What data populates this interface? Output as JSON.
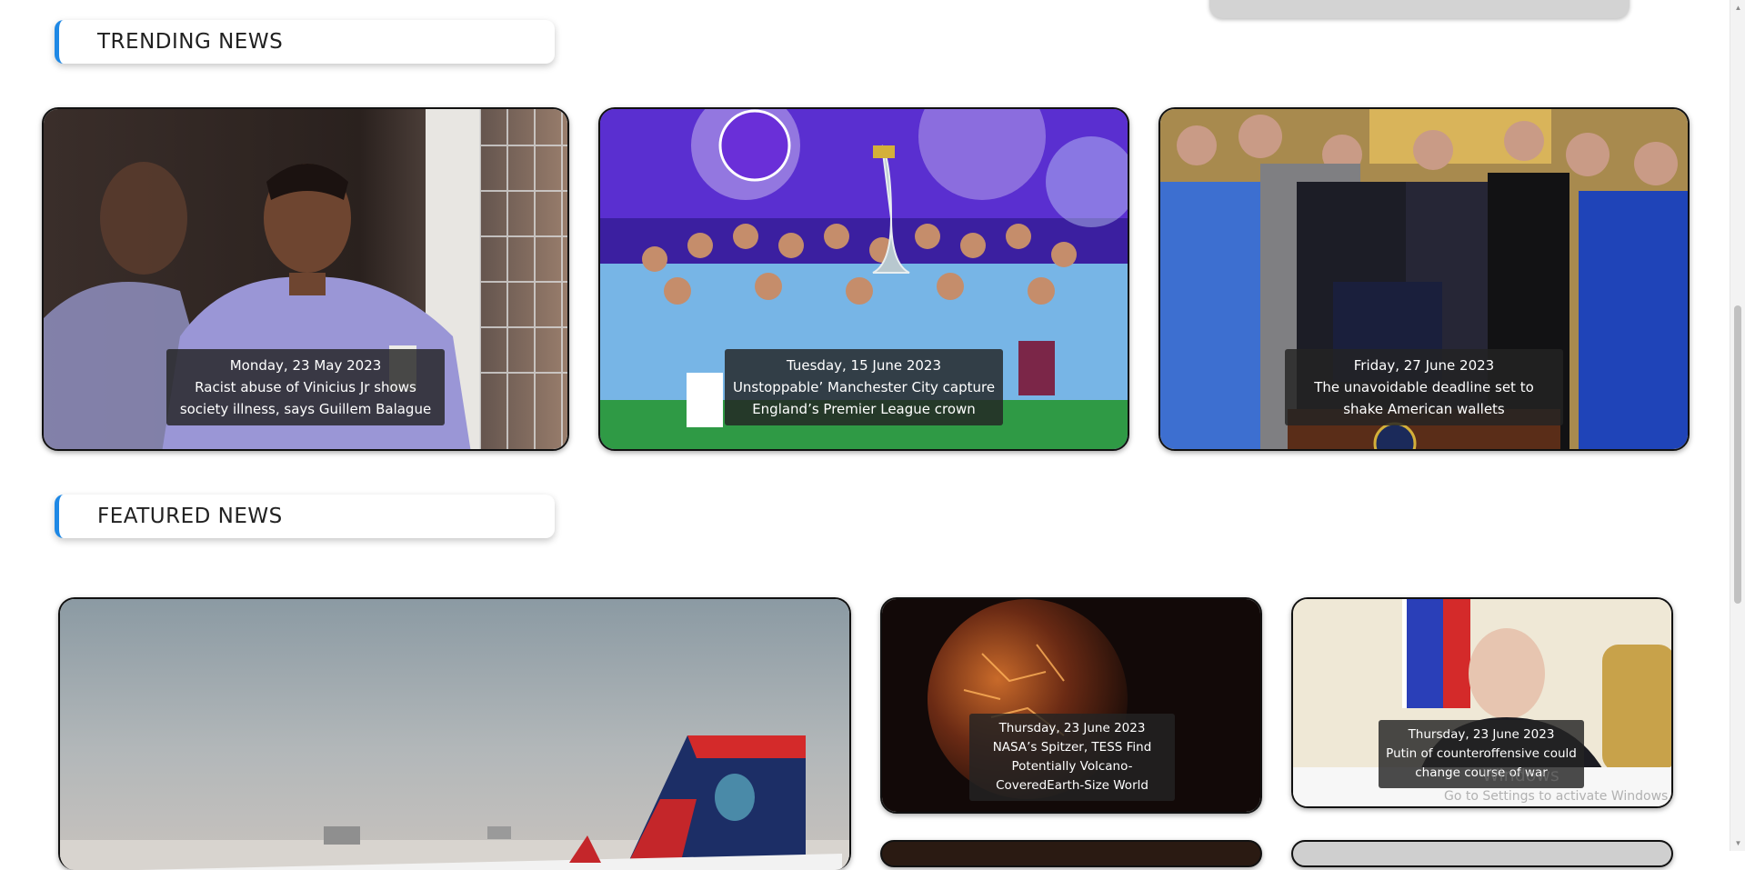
{
  "sections": {
    "trending_title": "TRENDING NEWS",
    "featured_title": "FEATURED NEWS"
  },
  "trending": [
    {
      "date": "Monday, 23 May 2023",
      "title": "Racist abuse of Vinicius Jr shows society illness, says Guillem Balague"
    },
    {
      "date": "Tuesday, 15 June 2023",
      "title": "Unstoppable’ Manchester City capture England’s Premier League crown"
    },
    {
      "date": "Friday, 27 June 2023",
      "title": "The unavoidable deadline set to shake American wallets"
    }
  ],
  "featured": [
    {
      "date": "Thursday, 23 June 2023",
      "title": "NASA’s Spitzer, TESS Find Potentially Volcano-CoveredEarth-Size World"
    },
    {
      "date": "Thursday, 23 June 2023",
      "title": "Putin of counteroffensive could change course of war"
    }
  ],
  "watermark": {
    "line1": "Windows",
    "line2": "Go to Settings to activate Windows."
  },
  "colors": {
    "accent": "#1e88e5",
    "caption_bg": "rgba(35,35,35,0.82)"
  },
  "icons": {
    "scroll_up": "triangle-up",
    "scroll_down": "triangle-down"
  }
}
